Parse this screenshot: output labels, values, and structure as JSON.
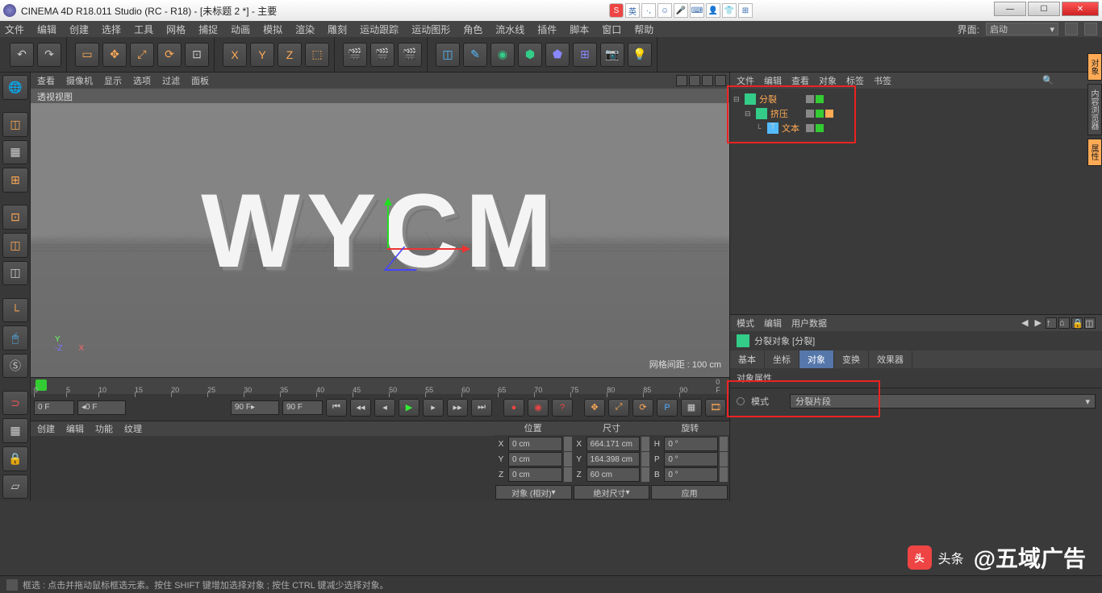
{
  "titlebar": {
    "text": "CINEMA 4D R18.011 Studio (RC - R18) - [未标题 2 *] - 主要"
  },
  "menubar": {
    "items": [
      "文件",
      "编辑",
      "创建",
      "选择",
      "工具",
      "网格",
      "捕捉",
      "动画",
      "模拟",
      "渲染",
      "雕刻",
      "运动跟踪",
      "运动图形",
      "角色",
      "流水线",
      "插件",
      "脚本",
      "窗口",
      "帮助"
    ],
    "layout_label": "界面:",
    "layout_value": "启动"
  },
  "viewport": {
    "menus": [
      "查看",
      "摄像机",
      "显示",
      "选项",
      "过滤",
      "面板"
    ],
    "title": "透视视图",
    "text3d": "WYCM",
    "grid_spacing": "网格间距 : 100 cm",
    "axes": {
      "x": "X",
      "y": "Y",
      "z": "-Z"
    }
  },
  "timeline": {
    "marks": [
      "0",
      "5",
      "10",
      "15",
      "20",
      "25",
      "30",
      "35",
      "40",
      "45",
      "50",
      "55",
      "60",
      "65",
      "70",
      "75",
      "80",
      "85",
      "90"
    ],
    "suffix": "0 F",
    "range_start": "0 F",
    "range_end": "90 F",
    "cur_start": "0 F",
    "cur_end": "90 F"
  },
  "coords_panel": {
    "menus": [
      "创建",
      "编辑",
      "功能",
      "纹理"
    ],
    "headers": [
      "位置",
      "尺寸",
      "旋转"
    ],
    "rows": [
      {
        "k": "X",
        "pos": "0 cm",
        "size": "664.171 cm",
        "rot_k": "H",
        "rot": "0 °"
      },
      {
        "k": "Y",
        "pos": "0 cm",
        "size": "164.398 cm",
        "rot_k": "P",
        "rot": "0 °"
      },
      {
        "k": "Z",
        "pos": "0 cm",
        "size": "60 cm",
        "rot_k": "B",
        "rot": "0 °"
      }
    ],
    "bottom": {
      "a": "对象 (相对)",
      "b": "绝对尺寸",
      "c": "应用"
    }
  },
  "object_manager": {
    "menus": [
      "文件",
      "编辑",
      "查看",
      "对象",
      "标签",
      "书签"
    ],
    "tree": [
      {
        "name": "分裂",
        "level": 0,
        "active": true,
        "icon": "split"
      },
      {
        "name": "挤压",
        "level": 1,
        "active": true,
        "icon": "extrude"
      },
      {
        "name": "文本",
        "level": 2,
        "active": true,
        "icon": "text"
      }
    ]
  },
  "attributes": {
    "menus": [
      "模式",
      "编辑",
      "用户数据"
    ],
    "title": "分裂对象 [分裂]",
    "tabs": [
      "基本",
      "坐标",
      "对象",
      "变换",
      "效果器"
    ],
    "active_tab": 2,
    "section": "对象属性",
    "mode_label": "模式",
    "mode_value": "分裂片段"
  },
  "side_tabs": [
    "对象",
    "内容浏览器",
    "属性"
  ],
  "statusbar": {
    "text": "框选 : 点击并拖动鼠标框选元素。按住 SHIFT 键增加选择对象 ; 按住 CTRL 键减少选择对象。"
  },
  "watermark": {
    "prefix": "头条",
    "text": "@五域广告"
  }
}
